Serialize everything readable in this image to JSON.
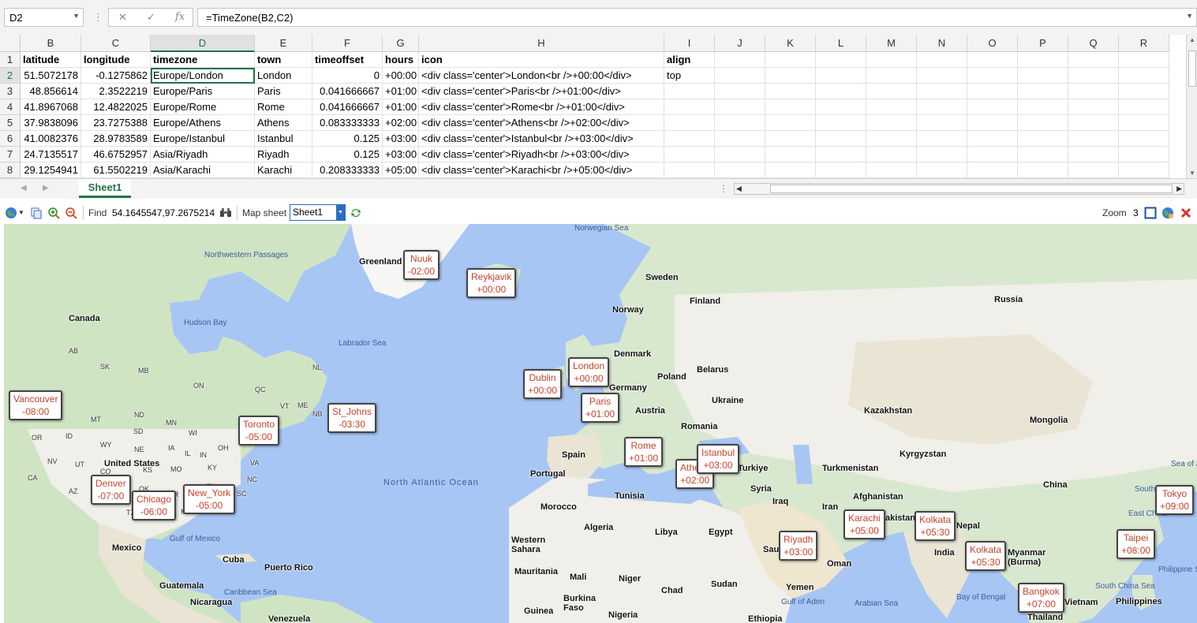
{
  "formula_bar": {
    "name_box": "D2",
    "formula": "=TimeZone(B2,C2)",
    "fx": "fx"
  },
  "columns": [
    "B",
    "C",
    "D",
    "E",
    "F",
    "G",
    "H",
    "I",
    "J",
    "K",
    "L",
    "M",
    "N",
    "O",
    "P",
    "Q",
    "R"
  ],
  "rows": [
    "1",
    "2",
    "3",
    "4",
    "5",
    "6",
    "7",
    "8"
  ],
  "headers": {
    "latitude": "latitude",
    "longitude": "longitude",
    "timezone": "timezone",
    "town": "town",
    "timeoffset": "timeoffset",
    "hours": "hours",
    "icon": "icon",
    "align": "align"
  },
  "table_rows": [
    {
      "latitude": "51.5072178",
      "longitude": "-0.1275862",
      "timezone": "Europe/London",
      "town": "London",
      "timeoffset": "0",
      "hours": "+00:00",
      "icon": "<div class='center'>London<br />+00:00</div>",
      "align": "top"
    },
    {
      "latitude": "48.856614",
      "longitude": "2.3522219",
      "timezone": "Europe/Paris",
      "town": "Paris",
      "timeoffset": "0.041666667",
      "hours": "+01:00",
      "icon": "<div class='center'>Paris<br />+01:00</div>",
      "align": ""
    },
    {
      "latitude": "41.8967068",
      "longitude": "12.4822025",
      "timezone": "Europe/Rome",
      "town": "Rome",
      "timeoffset": "0.041666667",
      "hours": "+01:00",
      "icon": "<div class='center'>Rome<br />+01:00</div>",
      "align": ""
    },
    {
      "latitude": "37.9838096",
      "longitude": "23.7275388",
      "timezone": "Europe/Athens",
      "town": "Athens",
      "timeoffset": "0.083333333",
      "hours": "+02:00",
      "icon": "<div class='center'>Athens<br />+02:00</div>",
      "align": ""
    },
    {
      "latitude": "41.0082376",
      "longitude": "28.9783589",
      "timezone": "Europe/Istanbul",
      "town": "Istanbul",
      "timeoffset": "0.125",
      "hours": "+03:00",
      "icon": "<div class='center'>Istanbul<br />+03:00</div>",
      "align": ""
    },
    {
      "latitude": "24.7135517",
      "longitude": "46.6752957",
      "timezone": "Asia/Riyadh",
      "town": "Riyadh",
      "timeoffset": "0.125",
      "hours": "+03:00",
      "icon": "<div class='center'>Riyadh<br />+03:00</div>",
      "align": ""
    },
    {
      "latitude": "29.1254941",
      "longitude": "61.5502219",
      "timezone": "Asia/Karachi",
      "town": "Karachi",
      "timeoffset": "0.208333333",
      "hours": "+05:00",
      "icon": "<div class='center'>Karachi<br />+05:00</div>",
      "align": ""
    }
  ],
  "sheet_tab": "Sheet1",
  "map_toolbar": {
    "find_label": "Find",
    "find_value": "54.1645547,97.2675214",
    "map_sheet_label": "Map sheet",
    "map_sheet_value": "Sheet1",
    "zoom_label": "Zoom",
    "zoom_value": "3"
  },
  "map": {
    "geo_labels": [
      "Norwegian Sea",
      "Greenland",
      "Northwestern Passages",
      "Sweden",
      "Finland",
      "Russia",
      "Norway",
      "Canada",
      "Hudson Bay",
      "Labrador Sea",
      "Denmark",
      "Belarus",
      "Poland",
      "Germany",
      "Ukraine",
      "Kazakhstan",
      "Mongolia",
      "Austria",
      "Romania",
      "Kyrgyzstan",
      "Turkmenistan",
      "Spain",
      "Portugal",
      "Syria",
      "Iraq",
      "Iran",
      "Afghanistan",
      "Tunisia",
      "Morocco",
      "Algeria",
      "Libya",
      "Egypt",
      "China",
      "Western Sahara",
      "Mauritania",
      "Mali",
      "Niger",
      "Chad",
      "Sudan",
      "Oman",
      "Yemen",
      "India",
      "United States",
      "Mexico",
      "Cuba",
      "Puerto Rico",
      "Guatemala",
      "Nicaragua",
      "Venezuela",
      "Burkina Faso",
      "Guinea",
      "Nigeria",
      "Ethiopia",
      "Philippines",
      "Arabian Sea",
      "Bay of Bengal",
      "Gulf of Mexico",
      "Caribbean Sea",
      "Gulf of Aden",
      "South China Sea",
      "Philippine S",
      "Sea of J",
      "North Atlantic Ocean",
      "AB",
      "SK",
      "MB",
      "ON",
      "QC",
      "NL",
      "NB",
      "NS",
      "MT",
      "ND",
      "MN",
      "SD",
      "WI",
      "WY",
      "NE",
      "IA",
      "OR",
      "ID",
      "NV",
      "UT",
      "CO",
      "KS",
      "MO",
      "CA",
      "AZ",
      "NM",
      "TX",
      "OK",
      "AR",
      "MS",
      "AL",
      "GA",
      "SC",
      "NC",
      "VA",
      "TN",
      "KY",
      "IL",
      "IN",
      "OH",
      "PA",
      "NY",
      "VT",
      "ME",
      "Rk",
      "Saudi",
      "akistan",
      "Nepal",
      "Myanmar (Burma)",
      "Thailand",
      "Vietnam",
      "South Korea",
      "East China",
      "Turkiye"
    ],
    "markers": [
      {
        "city": "Nuuk",
        "offset": "-02:00"
      },
      {
        "city": "Reykjavik",
        "offset": "+00:00"
      },
      {
        "city": "Vancouver",
        "offset": "-08:00"
      },
      {
        "city": "Toronto",
        "offset": "-05:00"
      },
      {
        "city": "St_Johns",
        "offset": "-03:30"
      },
      {
        "city": "Dublin",
        "offset": "+00:00"
      },
      {
        "city": "London",
        "offset": "+00:00"
      },
      {
        "city": "Paris",
        "offset": "+01:00"
      },
      {
        "city": "Rome",
        "offset": "+01:00"
      },
      {
        "city": "Athens",
        "offset": "+02:00"
      },
      {
        "city": "Istanbul",
        "offset": "+03:00"
      },
      {
        "city": "Denver",
        "offset": "-07:00"
      },
      {
        "city": "Chicago",
        "offset": "-06:00"
      },
      {
        "city": "New_York",
        "offset": "-05:00"
      },
      {
        "city": "Riyadh",
        "offset": "+03:00"
      },
      {
        "city": "Karachi",
        "offset": "+05:00"
      },
      {
        "city": "Kolkata",
        "offset": "+05:30"
      },
      {
        "city": "Kolkata",
        "offset": "+05:30"
      },
      {
        "city": "Bangkok",
        "offset": "+07:00"
      },
      {
        "city": "Taipei",
        "offset": "+08:00"
      },
      {
        "city": "Tokyo",
        "offset": "+09:00"
      }
    ]
  },
  "colors": {
    "excel_green": "#217346",
    "marker_text": "#c8432a",
    "water": "#a8c6f4",
    "land": "#f1efe9",
    "forest": "#c9e2c0"
  }
}
